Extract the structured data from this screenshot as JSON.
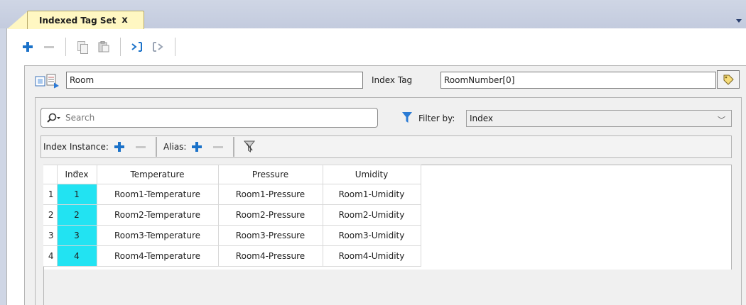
{
  "tab": {
    "title": "Indexed Tag Set",
    "close_label": "x"
  },
  "toolbar": {
    "add_icon": "plus-icon",
    "remove_icon": "minus-icon",
    "copy_icon": "copy-icon",
    "paste_icon": "paste-icon",
    "import_icon": "import-icon",
    "export_icon": "export-icon"
  },
  "set": {
    "name_value": "Room",
    "index_tag_label": "Index Tag",
    "index_tag_value": "RoomNumber[0]"
  },
  "search": {
    "placeholder": "Search",
    "filter_label": "Filter by:",
    "filter_value": "Index"
  },
  "subbar": {
    "index_instance_label": "Index Instance:",
    "alias_label": "Alias:"
  },
  "grid": {
    "columns": [
      "Index",
      "Temperature",
      "Pressure",
      "Umidity"
    ],
    "rows": [
      {
        "num": "1",
        "index": "1",
        "temperature": "Room1-Temperature",
        "pressure": "Room1-Pressure",
        "umidity": "Room1-Umidity"
      },
      {
        "num": "2",
        "index": "2",
        "temperature": "Room2-Temperature",
        "pressure": "Room2-Pressure",
        "umidity": "Room2-Umidity"
      },
      {
        "num": "3",
        "index": "3",
        "temperature": "Room3-Temperature",
        "pressure": "Room3-Pressure",
        "umidity": "Room3-Umidity"
      },
      {
        "num": "4",
        "index": "4",
        "temperature": "Room4-Temperature",
        "pressure": "Room4-Pressure",
        "umidity": "Room4-Umidity"
      }
    ]
  },
  "colors": {
    "accent": "#1b72c9",
    "index_cell": "#22e3f2",
    "tab_bg": "#fff7c2",
    "titlebar": "#cfd6e5"
  }
}
